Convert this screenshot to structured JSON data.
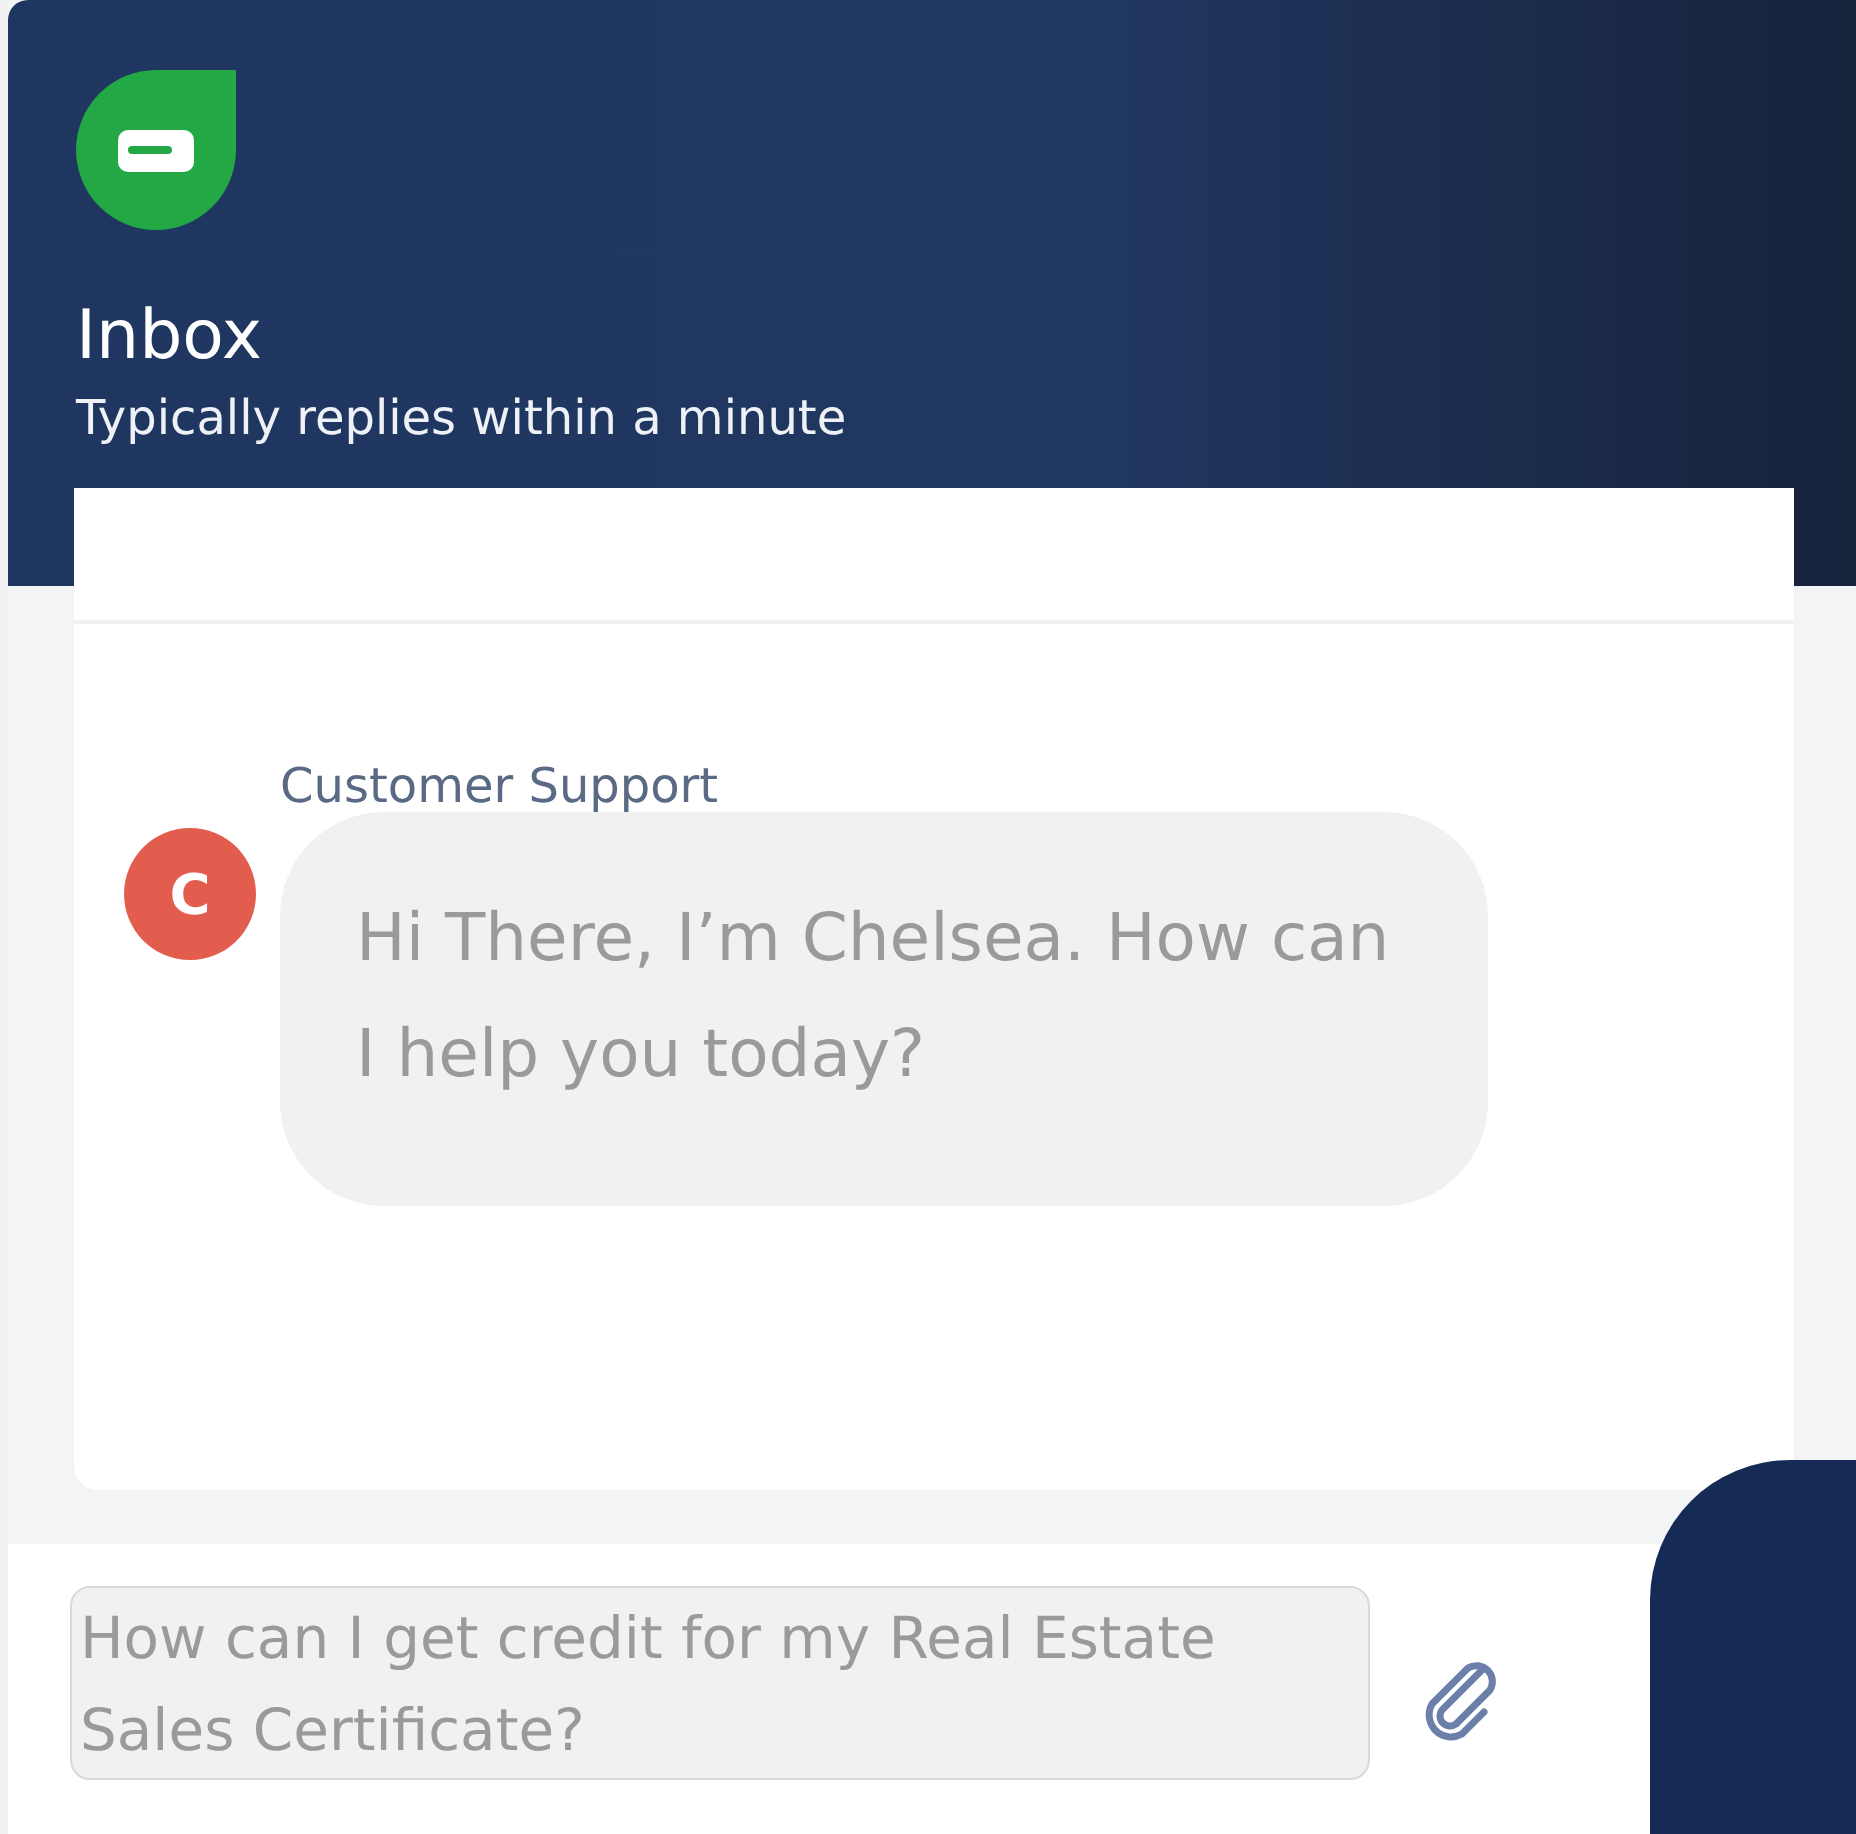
{
  "header": {
    "title": "Inbox",
    "subtitle": "Typically replies within a minute"
  },
  "messages": [
    {
      "sender": "Customer Support",
      "avatar_letter": "C",
      "text": "Hi There, I’m Chelsea. How can I help you today?"
    }
  ],
  "composer": {
    "placeholder": "How can I get credit for my Real Estate Sales Certificate?"
  }
}
